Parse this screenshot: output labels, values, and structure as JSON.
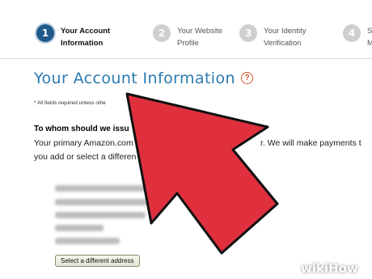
{
  "steps": [
    {
      "number": "1",
      "line1": "Your Account",
      "line2": "Information"
    },
    {
      "number": "2",
      "line1": "Your Website",
      "line2": "Profile"
    },
    {
      "number": "3",
      "line1": "Your Identity",
      "line2": "Verification"
    },
    {
      "number": "4",
      "line1": "S",
      "line2": "M"
    }
  ],
  "heading": {
    "title": "Your Account Information",
    "help_glyph": "?"
  },
  "required_note": "* All fields required unless othe",
  "address_section": {
    "question": "To whom should we issu",
    "text_line1_left": "Your primary Amazon.com",
    "text_line1_right": "r. We will make payments t",
    "text_line2": "you add or select a differen",
    "select_button": "Select a different address"
  },
  "watermark": {
    "part1": "wiki",
    "part2": "How"
  },
  "colors": {
    "accent": "#2a7ab0",
    "arrow": "#e0303e",
    "active_step": "#1f5a8a",
    "help": "#d8552b"
  }
}
